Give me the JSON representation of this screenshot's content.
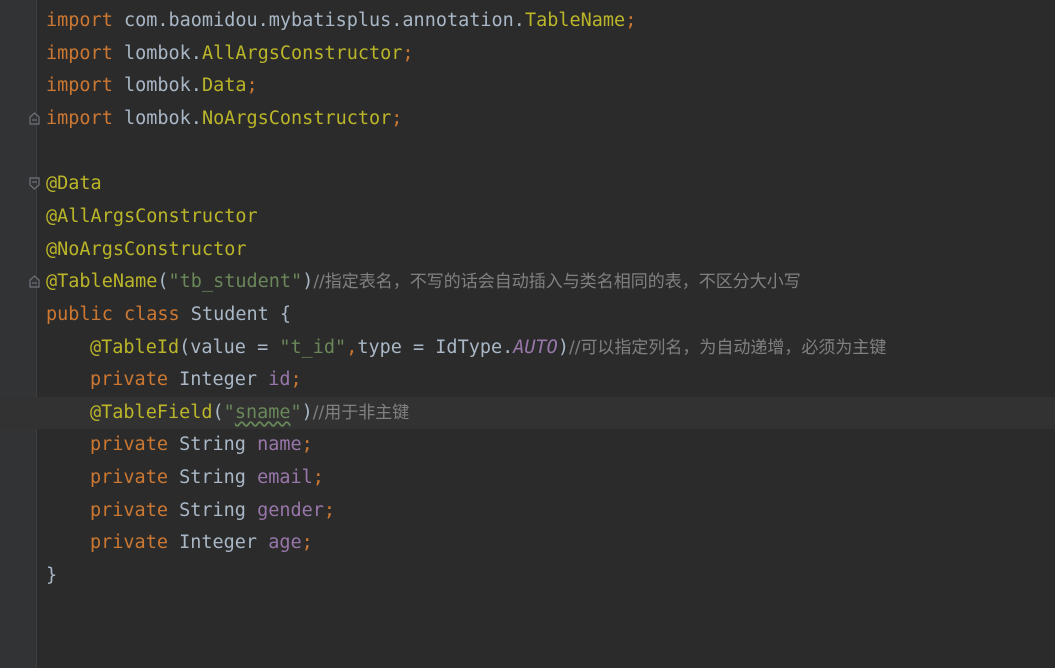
{
  "editor": {
    "lines": [
      {
        "id": "import-tablename",
        "tokens": [
          {
            "t": "import",
            "c": "kw"
          },
          {
            "t": " com.baomidou.mybatisplus.annotation.",
            "c": "pln"
          },
          {
            "t": "TableName",
            "c": "ann"
          },
          {
            "t": ";",
            "c": "kw"
          }
        ]
      },
      {
        "id": "import-allargs",
        "tokens": [
          {
            "t": "import",
            "c": "kw"
          },
          {
            "t": " lombok.",
            "c": "pln"
          },
          {
            "t": "AllArgsConstructor",
            "c": "ann"
          },
          {
            "t": ";",
            "c": "kw"
          }
        ]
      },
      {
        "id": "import-data",
        "tokens": [
          {
            "t": "import",
            "c": "kw"
          },
          {
            "t": " lombok.",
            "c": "pln"
          },
          {
            "t": "Data",
            "c": "ann"
          },
          {
            "t": ";",
            "c": "kw"
          }
        ]
      },
      {
        "id": "import-noargs",
        "fold": "end",
        "tokens": [
          {
            "t": "import",
            "c": "kw"
          },
          {
            "t": " lombok.",
            "c": "pln"
          },
          {
            "t": "NoArgsConstructor",
            "c": "ann"
          },
          {
            "t": ";",
            "c": "kw"
          }
        ]
      },
      {
        "id": "blank-1",
        "tokens": []
      },
      {
        "id": "annotation-data",
        "fold": "start",
        "tokens": [
          {
            "t": "@Data",
            "c": "ann"
          }
        ]
      },
      {
        "id": "annotation-allargs",
        "tokens": [
          {
            "t": "@AllArgsConstructor",
            "c": "ann"
          }
        ]
      },
      {
        "id": "annotation-noargs",
        "tokens": [
          {
            "t": "@NoArgsConstructor",
            "c": "ann"
          }
        ]
      },
      {
        "id": "annotation-tablename",
        "fold": "end",
        "tokens": [
          {
            "t": "@TableName",
            "c": "ann"
          },
          {
            "t": "(",
            "c": "pln"
          },
          {
            "t": "\"tb_student\"",
            "c": "str"
          },
          {
            "t": ")",
            "c": "pln"
          },
          {
            "t": "//",
            "c": "cmt"
          },
          {
            "t": "指定表名，不写的话会自动插入与类名相同的表，不区分大小写",
            "c": "cmt"
          }
        ]
      },
      {
        "id": "class-decl",
        "tokens": [
          {
            "t": "public",
            "c": "kw"
          },
          {
            "t": " ",
            "c": "pln"
          },
          {
            "t": "class",
            "c": "kw"
          },
          {
            "t": " Student {",
            "c": "pln"
          }
        ]
      },
      {
        "id": "annotation-tableid",
        "indent": 1,
        "tokens": [
          {
            "t": "@TableId",
            "c": "ann"
          },
          {
            "t": "(value = ",
            "c": "pln"
          },
          {
            "t": "\"t_id\"",
            "c": "str"
          },
          {
            "t": ",",
            "c": "kw"
          },
          {
            "t": "type = IdType.",
            "c": "pln"
          },
          {
            "t": "AUTO",
            "c": "cst"
          },
          {
            "t": ")",
            "c": "pln"
          },
          {
            "t": "//",
            "c": "cmt"
          },
          {
            "t": "可以指定列名，为自动递增，必须为主键",
            "c": "cmt"
          }
        ]
      },
      {
        "id": "field-id",
        "indent": 1,
        "tokens": [
          {
            "t": "private",
            "c": "kw"
          },
          {
            "t": " Integer ",
            "c": "pln"
          },
          {
            "t": "id",
            "c": "fld"
          },
          {
            "t": ";",
            "c": "kw"
          }
        ]
      },
      {
        "id": "annotation-tablefield",
        "indent": 1,
        "current": true,
        "tokens": [
          {
            "t": "@TableField",
            "c": "ann"
          },
          {
            "t": "(",
            "c": "pln"
          },
          {
            "t": "\"",
            "c": "str"
          },
          {
            "t": "sname",
            "c": "str typo"
          },
          {
            "t": "\"",
            "c": "str"
          },
          {
            "t": ")",
            "c": "pln"
          },
          {
            "t": "//",
            "c": "cmt"
          },
          {
            "t": "用于非主键",
            "c": "cmt"
          }
        ]
      },
      {
        "id": "field-name",
        "indent": 1,
        "tokens": [
          {
            "t": "private",
            "c": "kw"
          },
          {
            "t": " String ",
            "c": "pln"
          },
          {
            "t": "name",
            "c": "fld"
          },
          {
            "t": ";",
            "c": "kw"
          }
        ]
      },
      {
        "id": "field-email",
        "indent": 1,
        "tokens": [
          {
            "t": "private",
            "c": "kw"
          },
          {
            "t": " String ",
            "c": "pln"
          },
          {
            "t": "email",
            "c": "fld"
          },
          {
            "t": ";",
            "c": "kw"
          }
        ]
      },
      {
        "id": "field-gender",
        "indent": 1,
        "tokens": [
          {
            "t": "private",
            "c": "kw"
          },
          {
            "t": " String ",
            "c": "pln"
          },
          {
            "t": "gender",
            "c": "fld"
          },
          {
            "t": ";",
            "c": "kw"
          }
        ]
      },
      {
        "id": "field-age",
        "indent": 1,
        "tokens": [
          {
            "t": "private",
            "c": "kw"
          },
          {
            "t": " Integer ",
            "c": "pln"
          },
          {
            "t": "age",
            "c": "fld"
          },
          {
            "t": ";",
            "c": "kw"
          }
        ]
      },
      {
        "id": "class-close",
        "tokens": [
          {
            "t": "}",
            "c": "pln"
          }
        ]
      }
    ]
  },
  "colors": {
    "background": "#2b2b2b",
    "gutter": "#313335",
    "current_line": "#323232",
    "keyword": "#cc7832",
    "annotation": "#bbb529",
    "string": "#6a8759",
    "field": "#9876aa",
    "comment": "#808080",
    "plain": "#a9b7c6"
  }
}
